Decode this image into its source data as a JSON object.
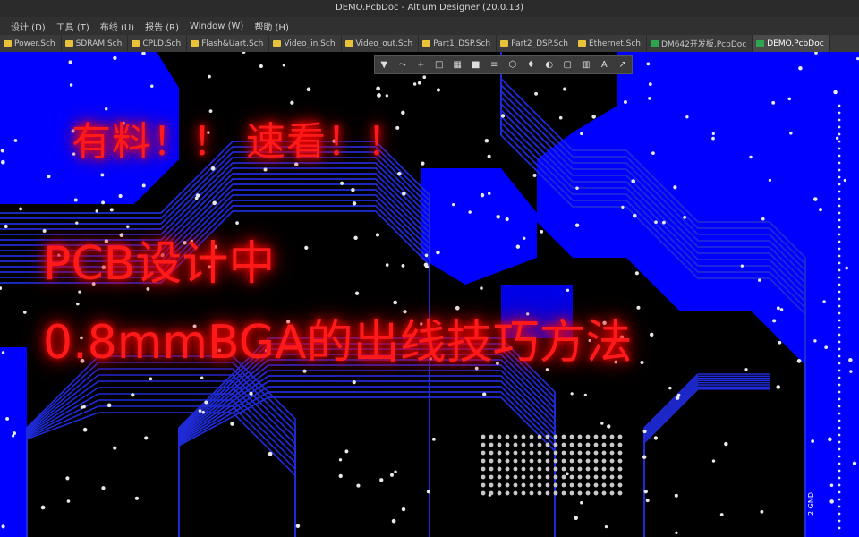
{
  "window": {
    "title": "DEMO.PcbDoc - Altium Designer (20.0.13)"
  },
  "menu": [
    "设计 (D)",
    "工具 (T)",
    "布线 (U)",
    "报告 (R)",
    "Window (W)",
    "帮助 (H)"
  ],
  "tabs": [
    {
      "label": "Power.Sch",
      "icon": "folder-icon"
    },
    {
      "label": "SDRAM.Sch",
      "icon": "folder-icon"
    },
    {
      "label": "CPLD.Sch",
      "icon": "folder-icon"
    },
    {
      "label": "Flash&Uart.Sch",
      "icon": "folder-icon"
    },
    {
      "label": "Video_in.Sch",
      "icon": "folder-icon"
    },
    {
      "label": "Video_out.Sch",
      "icon": "folder-icon"
    },
    {
      "label": "Part1_DSP.Sch",
      "icon": "folder-icon"
    },
    {
      "label": "Part2_DSP.Sch",
      "icon": "folder-icon"
    },
    {
      "label": "Ethernet.Sch",
      "icon": "folder-icon"
    },
    {
      "label": "DM642开发板.PcbDoc",
      "icon": "pcb-icon"
    },
    {
      "label": "DEMO.PcbDoc",
      "icon": "pcb-icon",
      "active": true
    }
  ],
  "toolbar": [
    "filter-icon",
    "route-icon",
    "plus-icon",
    "rect-icon",
    "chip-icon",
    "fill-icon",
    "align-icon",
    "polygon-icon",
    "pin-icon",
    "color-icon",
    "box-icon",
    "chart-icon",
    "text-icon",
    "dimension-icon"
  ],
  "overlay": {
    "headline": "有料！！ 速看！！",
    "line1": "PCB设计中",
    "line2": "0.8mmBGA的出线技巧方法"
  },
  "canvas": {
    "layer_label": "GND",
    "layer_number": "2"
  },
  "colors": {
    "copper_blue": "#0000ff",
    "trace_blue": "#1f2bd8",
    "via_white": "#e8e8e8",
    "text_red": "#ff1a1a"
  }
}
